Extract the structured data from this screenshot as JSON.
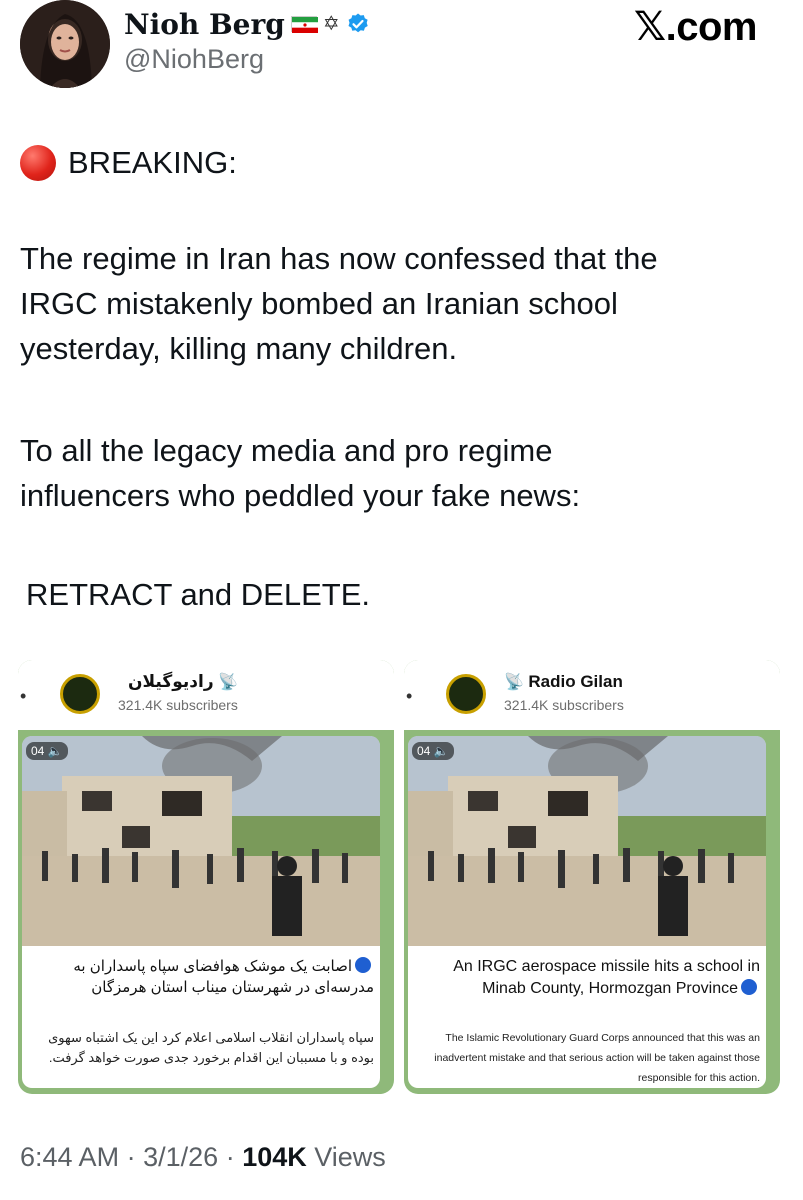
{
  "author": {
    "display_name": "Nioh Berg",
    "handle": "@NiohBerg",
    "badges": [
      "iran-flag-icon",
      "star-of-david-icon",
      "verified-icon"
    ]
  },
  "brand": "𝕏.com",
  "tweet": {
    "breaking": "BREAKING:",
    "paragraph1": [
      "The regime in Iran has now confessed that the",
      "IRGC mistakenly bombed an Iranian school",
      "yesterday, killing many children."
    ],
    "paragraph2": [
      "To all the legacy media and pro regime",
      "influencers who peddled your fake news:"
    ],
    "paragraph3": "RETRACT and DELETE."
  },
  "media_left": {
    "channel_name": "راديوگيلان",
    "subscribers": "321.4K subscribers",
    "duration": "04",
    "caption_main": "اصابت یک موشک هوافضای سپاه پاسداران به مدرسه‌ای در شهرستان میناب استان هرمزگان",
    "caption_sub": "سپاه پاسداران انقلاب اسلامی اعلام کرد این یک اشتباه سهوی بوده و با مسببان این اقدام برخورد جدی صورت خواهد گرفت."
  },
  "media_right": {
    "channel_name": "Radio Gilan",
    "subscribers": "321.4K subscribers",
    "duration": "04",
    "caption_main": "An IRGC aerospace missile hits a school in Minab County, Hormozgan Province",
    "caption_sub": "The Islamic Revolutionary Guard Corps announced that this was an inadvertent mistake and that serious action will be taken against those responsible for this action."
  },
  "meta": {
    "time": "6:44 AM",
    "date": "3/1/26",
    "views_count": "104K",
    "views_label": "Views",
    "separator": "·"
  },
  "colors": {
    "text": "#0f1419",
    "secondary": "#6b6f73",
    "verified": "#1d9bf0",
    "telegram_bg": "#8fb97a"
  }
}
